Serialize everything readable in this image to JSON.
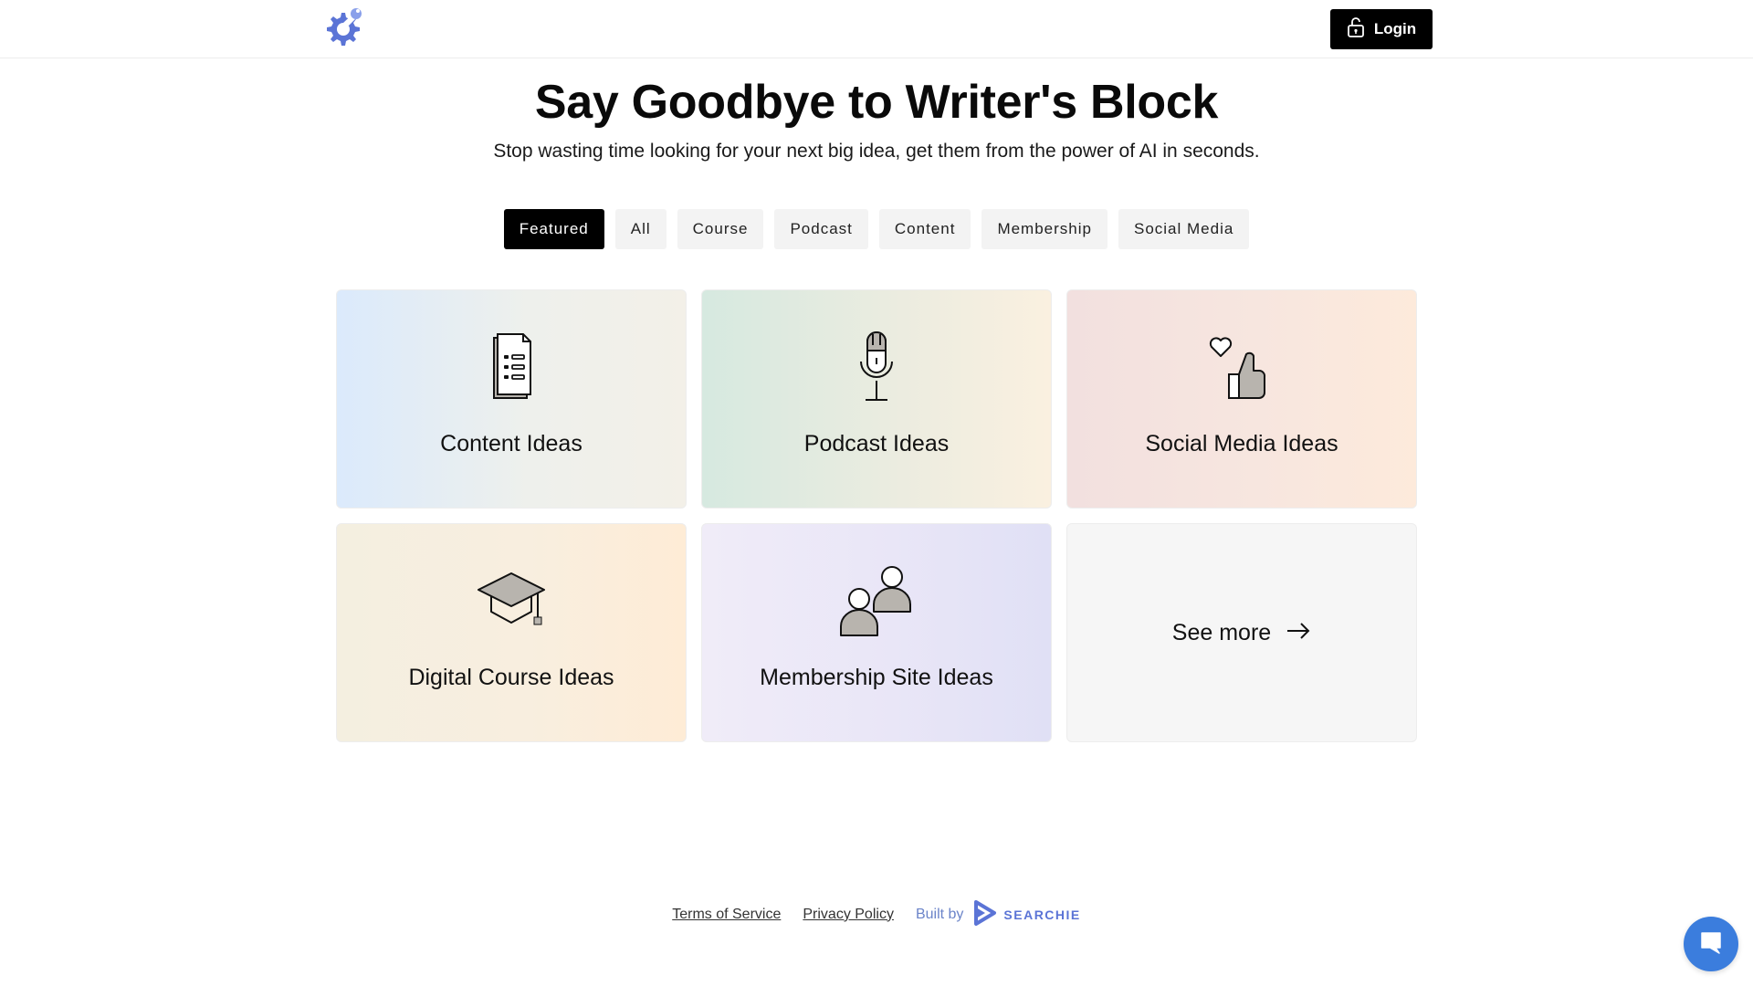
{
  "header": {
    "logo_icon": "gear-logo-icon",
    "login_label": "Login",
    "login_icon": "lock-icon"
  },
  "hero": {
    "title": "Say Goodbye to Writer's Block",
    "subtitle": "Stop wasting time looking for your next big idea, get them from the power of AI in seconds."
  },
  "filters": {
    "items": [
      "Featured",
      "All",
      "Course",
      "Podcast",
      "Content",
      "Membership",
      "Social Media"
    ],
    "active": "Featured"
  },
  "cards": [
    {
      "label": "Content Ideas",
      "icon": "document-list-icon"
    },
    {
      "label": "Podcast Ideas",
      "icon": "microphone-icon"
    },
    {
      "label": "Social Media Ideas",
      "icon": "thumbs-up-heart-icon"
    },
    {
      "label": "Digital Course Ideas",
      "icon": "graduation-cap-icon"
    },
    {
      "label": "Membership Site Ideas",
      "icon": "people-icon"
    },
    {
      "label": "See more",
      "icon": "arrow-right-icon"
    }
  ],
  "footer": {
    "terms": "Terms of Service",
    "privacy": "Privacy Policy",
    "built_by": "Built by",
    "brand": "SEARCHIE"
  },
  "chat": {
    "icon": "chat-bubble-icon"
  },
  "colors": {
    "accent": "#5b74d6",
    "primary_button": "#000000",
    "chat": "#3b7ddd"
  }
}
